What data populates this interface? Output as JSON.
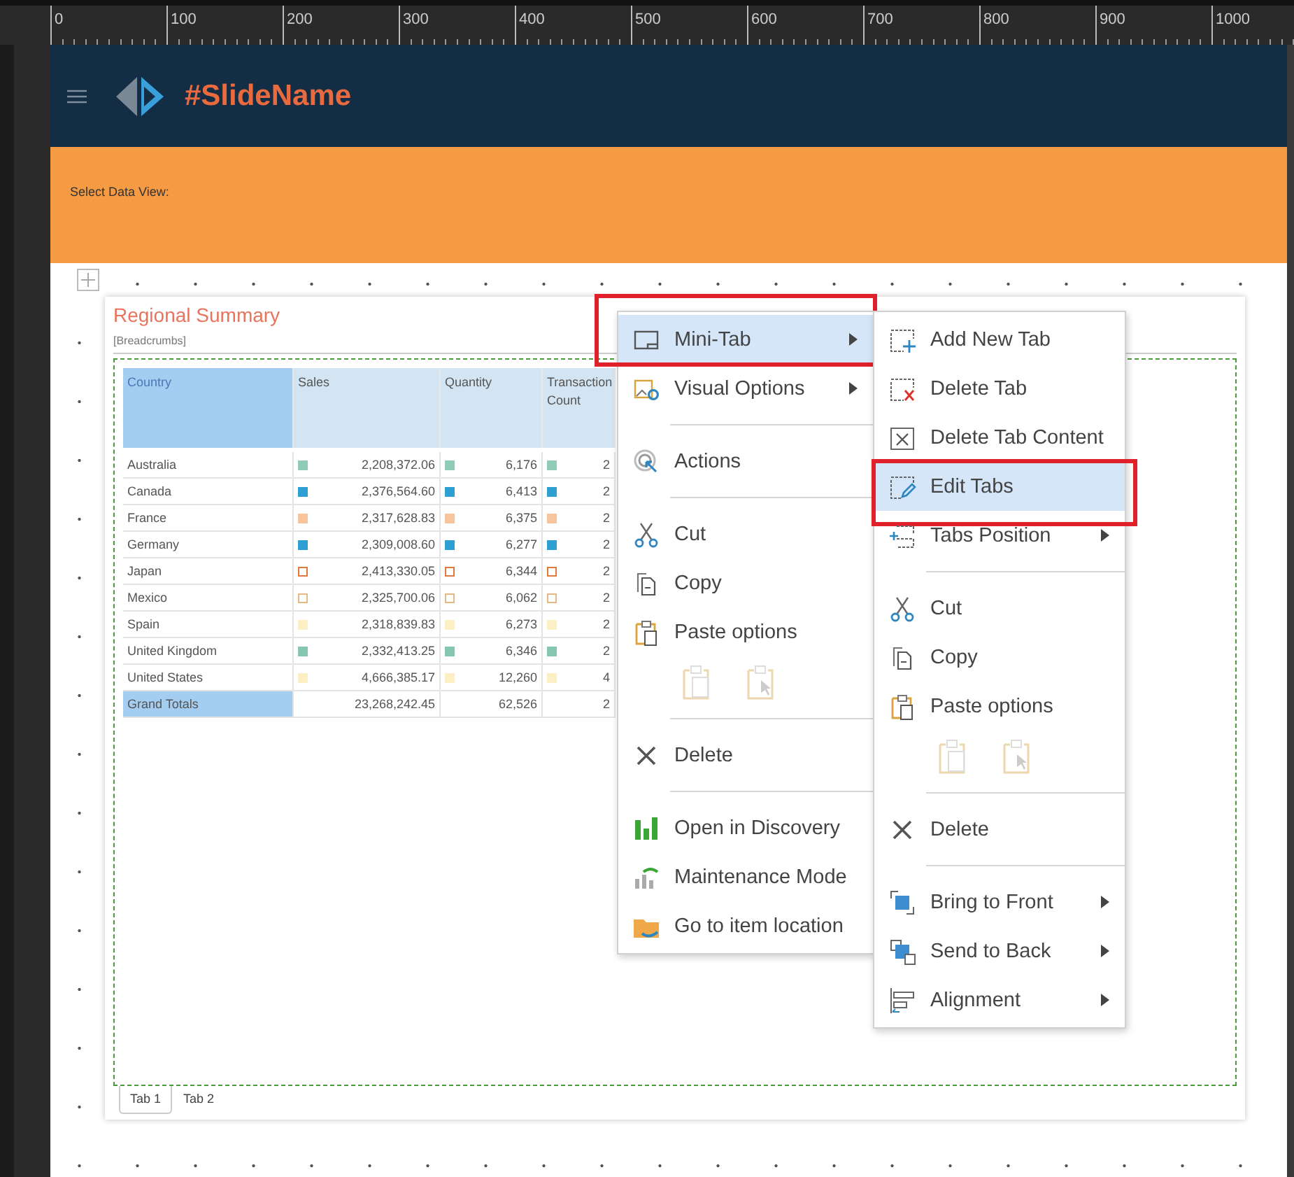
{
  "ruler": {
    "labels": [
      "0",
      "100",
      "200",
      "300",
      "400",
      "500",
      "600",
      "700",
      "800",
      "900",
      "1000"
    ]
  },
  "header": {
    "title": "#SlideName"
  },
  "filter_bar": {
    "label": "Select Data View:"
  },
  "card": {
    "title": "Regional Summary",
    "breadcrumbs": "[Breadcrumbs]",
    "table": {
      "columns": [
        "Country",
        "Sales",
        "Quantity",
        "Transaction Count"
      ],
      "rows": [
        {
          "country": "Australia",
          "color": "#8fcbb6",
          "outline": false,
          "values": [
            "2,208,372.06",
            "6,176",
            "2"
          ]
        },
        {
          "country": "Canada",
          "color": "#2e9fd2",
          "outline": false,
          "values": [
            "2,376,564.60",
            "6,413",
            "2"
          ]
        },
        {
          "country": "France",
          "color": "#f7c49b",
          "outline": false,
          "values": [
            "2,317,628.83",
            "6,375",
            "2"
          ]
        },
        {
          "country": "Germany",
          "color": "#2e9fd2",
          "outline": false,
          "values": [
            "2,309,008.60",
            "6,277",
            "2"
          ]
        },
        {
          "country": "Japan",
          "color": "#e0793a",
          "outline": true,
          "values": [
            "2,413,330.05",
            "6,344",
            "2"
          ]
        },
        {
          "country": "Mexico",
          "color": "#e6b886",
          "outline": true,
          "values": [
            "2,325,700.06",
            "6,062",
            "2"
          ]
        },
        {
          "country": "Spain",
          "color": "#fcefc4",
          "outline": false,
          "values": [
            "2,318,839.83",
            "6,273",
            "2"
          ]
        },
        {
          "country": "United Kingdom",
          "color": "#84c6ae",
          "outline": false,
          "values": [
            "2,332,413.25",
            "6,346",
            "2"
          ]
        },
        {
          "country": "United States",
          "color": "#fcefc4",
          "outline": false,
          "values": [
            "4,666,385.17",
            "12,260",
            "4"
          ]
        }
      ],
      "totals": {
        "label": "Grand Totals",
        "values": [
          "23,268,242.45",
          "62,526",
          "2"
        ]
      }
    },
    "tabs": [
      {
        "label": "Tab 1",
        "selected": true
      },
      {
        "label": "Tab 2",
        "selected": false
      }
    ]
  },
  "context_menu": {
    "items": [
      {
        "kind": "item",
        "label": "Mini-Tab",
        "submenu": true,
        "selected": true,
        "annotated": true
      },
      {
        "kind": "item",
        "label": "Visual Options",
        "submenu": true,
        "selected": false,
        "annotated": false
      },
      {
        "kind": "separator"
      },
      {
        "kind": "item",
        "label": "Actions",
        "submenu": false,
        "selected": false,
        "annotated": false
      },
      {
        "kind": "separator"
      },
      {
        "kind": "item",
        "label": "Cut",
        "submenu": false,
        "selected": false,
        "annotated": false
      },
      {
        "kind": "item",
        "label": "Copy",
        "submenu": false,
        "selected": false,
        "annotated": false
      },
      {
        "kind": "paste",
        "label": "Paste options"
      },
      {
        "kind": "separator"
      },
      {
        "kind": "item",
        "label": "Delete",
        "submenu": false,
        "selected": false,
        "annotated": false
      },
      {
        "kind": "separator"
      },
      {
        "kind": "item",
        "label": "Open in Discovery",
        "submenu": false,
        "selected": false,
        "annotated": false
      },
      {
        "kind": "item",
        "label": "Maintenance Mode",
        "submenu": false,
        "selected": false,
        "annotated": false
      },
      {
        "kind": "item",
        "label": "Go to item location",
        "submenu": false,
        "selected": false,
        "annotated": false
      }
    ]
  },
  "submenu": {
    "items": [
      {
        "kind": "item",
        "label": "Add New Tab",
        "submenu": false,
        "selected": false,
        "annotated": false
      },
      {
        "kind": "item",
        "label": "Delete Tab",
        "submenu": false,
        "selected": false,
        "annotated": false
      },
      {
        "kind": "item",
        "label": "Delete Tab Content",
        "submenu": false,
        "selected": false,
        "annotated": false
      },
      {
        "kind": "item",
        "label": "Edit Tabs",
        "submenu": false,
        "selected": true,
        "annotated": true
      },
      {
        "kind": "item",
        "label": "Tabs Position",
        "submenu": true,
        "selected": false,
        "annotated": false
      },
      {
        "kind": "separator"
      },
      {
        "kind": "item",
        "label": "Cut",
        "submenu": false,
        "selected": false,
        "annotated": false
      },
      {
        "kind": "item",
        "label": "Copy",
        "submenu": false,
        "selected": false,
        "annotated": false
      },
      {
        "kind": "paste",
        "label": "Paste options"
      },
      {
        "kind": "separator"
      },
      {
        "kind": "item",
        "label": "Delete",
        "submenu": false,
        "selected": false,
        "annotated": false
      },
      {
        "kind": "separator"
      },
      {
        "kind": "item",
        "label": "Bring to Front",
        "submenu": true,
        "selected": false,
        "annotated": false
      },
      {
        "kind": "item",
        "label": "Send to Back",
        "submenu": true,
        "selected": false,
        "annotated": false
      },
      {
        "kind": "item",
        "label": "Alignment",
        "submenu": true,
        "selected": false,
        "annotated": false
      }
    ]
  }
}
